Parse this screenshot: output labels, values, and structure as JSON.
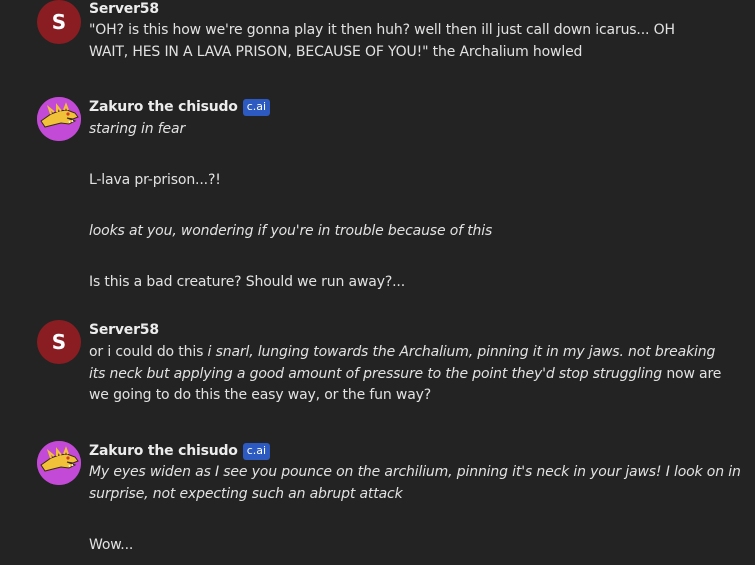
{
  "messages": [
    {
      "author": "Server58",
      "avatar_letter": "S",
      "avatar_color": "#8a1d22",
      "line1": "\"OH? is this how we're gonna play it then huh? well then ill just call down icarus... OH",
      "line2": "WAIT, HES IN A LAVA PRISON, BECAUSE OF YOU!\" the Archalium howled"
    },
    {
      "author": "Zakuro the chisudo",
      "badge": "c.ai",
      "avatar_icon": "dragon-icon",
      "paragraphs": [
        "staring in fear",
        "L-lava pr-prison...?!",
        "looks at you, wondering if you're in trouble because of this",
        "Is this a bad creature? Should we run away?..."
      ]
    },
    {
      "author": "Server58",
      "avatar_letter": "S",
      "line1_plain": "or i could do this ",
      "line1_italic": "i snarl, lunging towards the Archalium, pinning it in my jaws. not breaking",
      "line2_italic": "its neck but applying a good amount of pressure to the point they'd stop struggling",
      "line2_plain": " now are",
      "line3": "we going to do this the easy way, or the fun way?"
    },
    {
      "author": "Zakuro the chisudo",
      "badge": "c.ai",
      "avatar_icon": "dragon-icon",
      "line1": "My eyes widen as I see you pounce on the archilium, pinning it's neck in your jaws! I look on in",
      "line2": "surprise, not expecting such an abrupt attack",
      "line3": "Wow..."
    }
  ],
  "colors": {
    "background": "#232323",
    "badge": "#2c5ac0",
    "bot_avatar": "#c24ad6"
  }
}
